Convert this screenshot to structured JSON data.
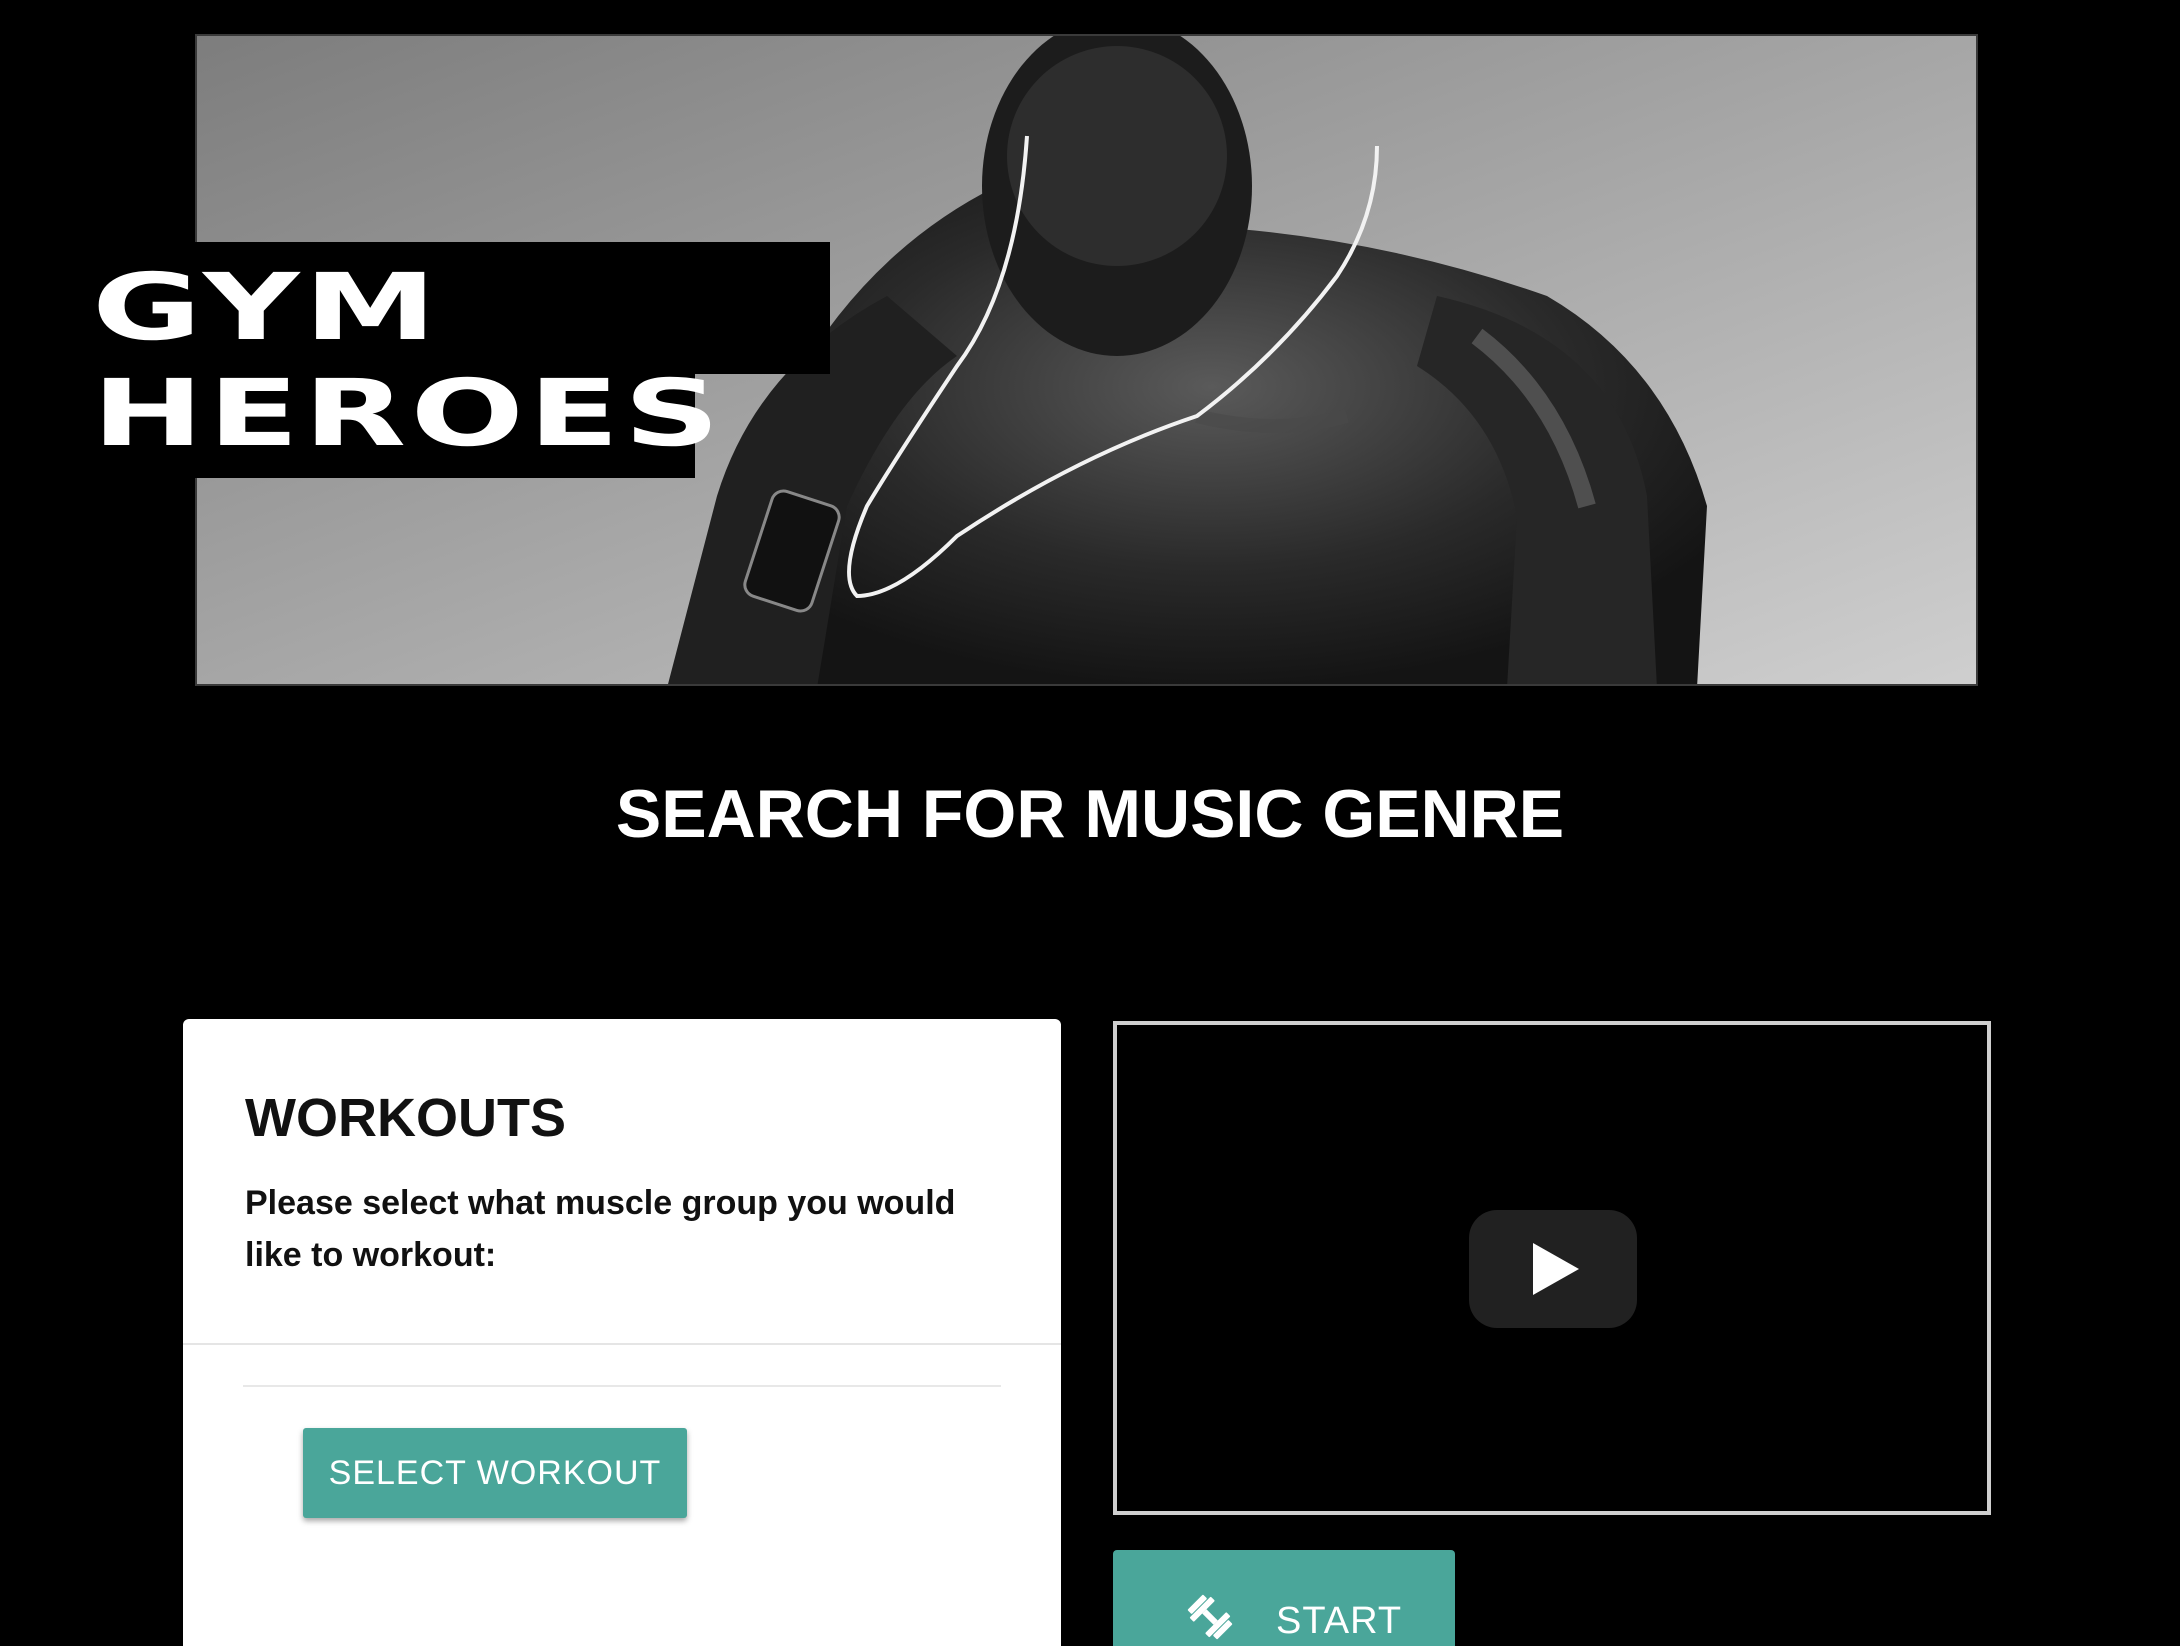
{
  "hero": {
    "logo_line1": "GYM",
    "logo_line2": "HEROES"
  },
  "section": {
    "title": "SEARCH FOR MUSIC GENRE"
  },
  "workouts_card": {
    "title": "WORKOUTS",
    "prompt": "Please select what muscle group you would like to workout:",
    "select_button": "SELECT WORKOUT",
    "accent_color": "#4aa69a"
  },
  "video": {
    "play_icon": "play-icon"
  },
  "start_button": {
    "label": "START",
    "icon": "dumbbell-icon"
  }
}
